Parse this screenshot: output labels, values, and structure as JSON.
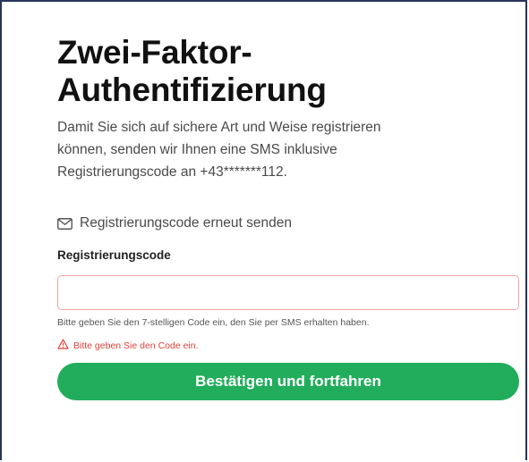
{
  "page": {
    "title_line1": "Zwei-Faktor-",
    "title_line2": "Authentifizierung",
    "description_line1": "Damit Sie sich auf sichere Art und Weise registrieren",
    "description_line2": "können, senden wir Ihnen eine SMS inklusive",
    "description_line3": "Registrierungscode an +43*******112."
  },
  "resend": {
    "icon": "envelope-icon",
    "label": "Registrierungscode erneut senden"
  },
  "code_field": {
    "label": "Registrierungscode",
    "value": "",
    "placeholder": "",
    "hint": "Bitte geben Sie den 7-stelligen Code ein, den Sie per SMS erhalten haben.",
    "error": "Bitte geben Sie den Code ein.",
    "error_icon": "warning-triangle-icon"
  },
  "submit": {
    "label": "Bestätigen und fortfahren"
  },
  "colors": {
    "primary_button": "#22ad5c",
    "error": "#e0413a",
    "input_error_border": "#f0a4a4",
    "frame_border": "#27345c"
  }
}
